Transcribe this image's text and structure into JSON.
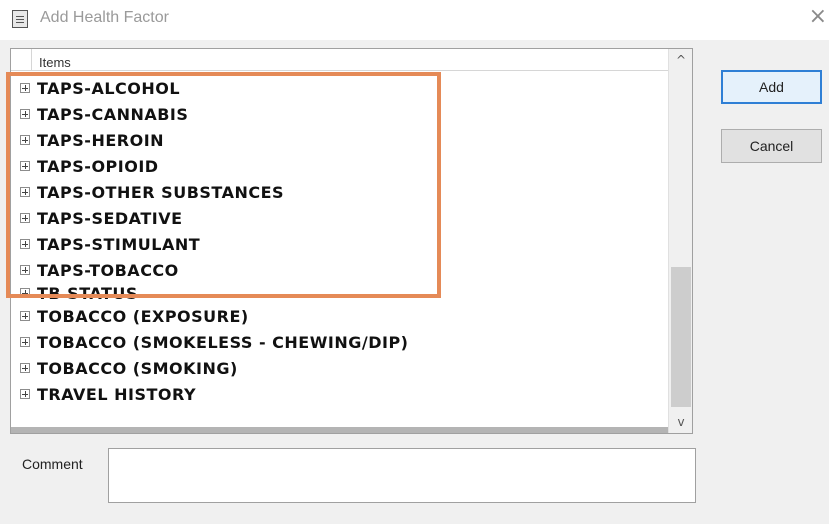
{
  "window": {
    "title": "Add Health Factor",
    "close_glyph": "×"
  },
  "listbox": {
    "column_header": "Items",
    "items": [
      {
        "label": "TAPS-ALCOHOL"
      },
      {
        "label": "TAPS-CANNABIS"
      },
      {
        "label": "TAPS-HEROIN"
      },
      {
        "label": "TAPS-OPIOID"
      },
      {
        "label": "TAPS-OTHER SUBSTANCES"
      },
      {
        "label": "TAPS-SEDATIVE"
      },
      {
        "label": "TAPS-STIMULANT"
      },
      {
        "label": "TAPS-TOBACCO"
      },
      {
        "label": "TB STATUS"
      },
      {
        "label": "TOBACCO (EXPOSURE)"
      },
      {
        "label": "TOBACCO (SMOKELESS - CHEWING/DIP)"
      },
      {
        "label": "TOBACCO (SMOKING)"
      },
      {
        "label": "TRAVEL HISTORY"
      }
    ],
    "scroll_up_glyph": "^",
    "scroll_down_glyph": "v"
  },
  "buttons": {
    "add": "Add",
    "cancel": "Cancel"
  },
  "comment": {
    "label": "Comment",
    "value": ""
  },
  "colors": {
    "highlight": "#e58a57",
    "default_button_border": "#2f7fd5"
  }
}
